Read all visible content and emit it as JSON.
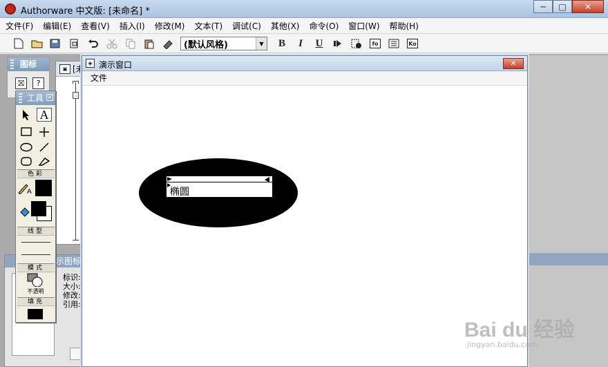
{
  "window": {
    "title": "Authorware 中文版: [未命名] *",
    "min": "─",
    "max": "□",
    "close": "✕"
  },
  "menubar": [
    "文件(F)",
    "编辑(E)",
    "查看(V)",
    "插入(I)",
    "修改(M)",
    "文本(T)",
    "调试(C)",
    "其他(X)",
    "命令(O)",
    "窗口(W)",
    "帮助(H)"
  ],
  "toolbar": {
    "style_value": "(默认风格)",
    "bold": "B",
    "italic": "I",
    "underline": "U",
    "icons": [
      "new-icon",
      "open-icon",
      "save-all-icon",
      "import-icon",
      "undo-icon",
      "cut-icon",
      "copy-icon",
      "paste-icon",
      "find-icon",
      "control-panel-icon",
      "functions-icon",
      "variables-icon",
      "knowledge-objects-icon"
    ],
    "fn_label": "fo",
    "var_label": "Ko"
  },
  "icon_palette": {
    "title": "图标"
  },
  "tools_palette": {
    "title": "工具",
    "color_section": "色彩",
    "line_section": "线型",
    "mode_section": "模式",
    "mode_value": "不透明",
    "fill_section": "填充",
    "colors": {
      "line": "#000000",
      "fill_fg": "#000000",
      "fill_bg": "#ffffff"
    }
  },
  "design_window": {
    "title": "[未"
  },
  "property_panel": {
    "title": "示图标",
    "fields": [
      "标识:",
      "大小:",
      "修改:",
      "引用:"
    ]
  },
  "presentation": {
    "title": "演示窗口",
    "menu": "文件",
    "ellipse_text": "椭圆",
    "ellipse_color": "#000000"
  },
  "watermark": {
    "main": "Bai du 经验",
    "sub": "jingyan.baidu.com"
  }
}
